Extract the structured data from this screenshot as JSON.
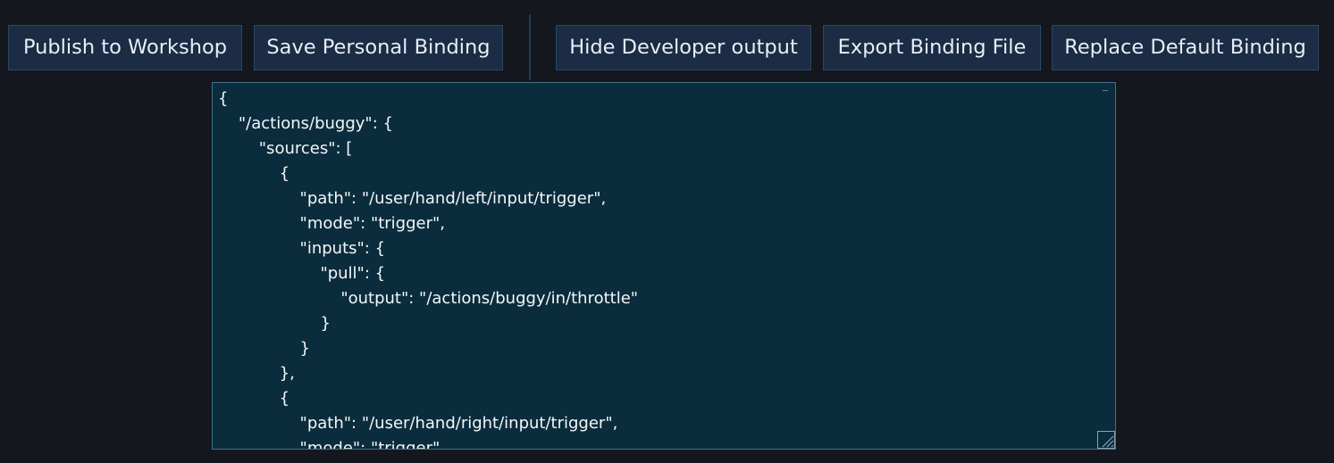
{
  "toolbar": {
    "publish_label": "Publish to Workshop",
    "save_label": "Save Personal Binding",
    "hide_dev_label": "Hide Developer output",
    "export_label": "Export Binding File",
    "replace_label": "Replace Default Binding"
  },
  "editor": {
    "lines": [
      "{",
      "\t\"/actions/buggy\": {",
      "\t\t\"sources\": [",
      "\t\t\t{",
      "\t\t\t\t\"path\": \"/user/hand/left/input/trigger\",",
      "\t\t\t\t\"mode\": \"trigger\",",
      "\t\t\t\t\"inputs\": {",
      "\t\t\t\t\t\"pull\": {",
      "\t\t\t\t\t\t\"output\": \"/actions/buggy/in/throttle\"",
      "\t\t\t\t\t}",
      "\t\t\t\t}",
      "\t\t\t},",
      "\t\t\t{",
      "\t\t\t\t\"path\": \"/user/hand/right/input/trigger\",",
      "\t\t\t\t\"mode\": \"trigger\","
    ]
  },
  "colors": {
    "background": "#14171d",
    "button_bg": "#1b2c44",
    "button_text": "#e8eef6",
    "editor_bg": "#0b2c3d",
    "editor_border": "#3d7488"
  }
}
